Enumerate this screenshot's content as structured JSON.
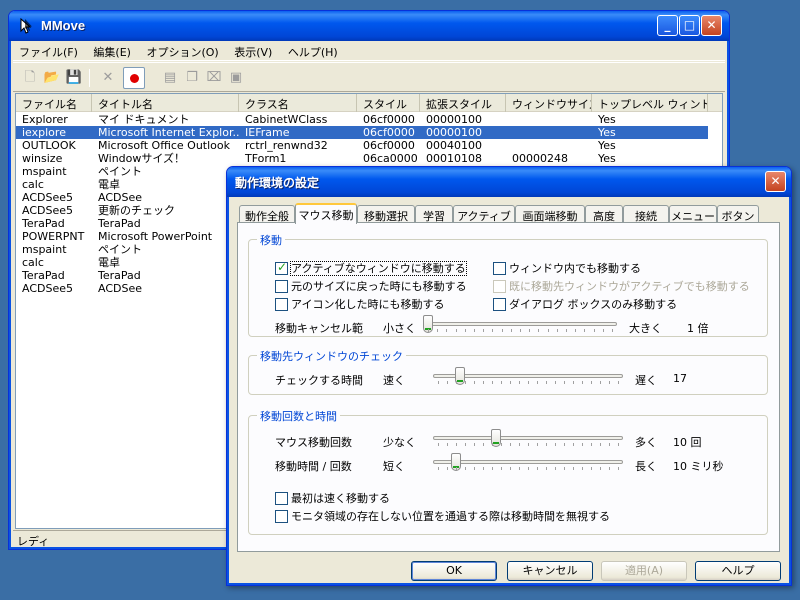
{
  "main": {
    "title": "MMove",
    "menu": [
      "ファイル(F)",
      "編集(E)",
      "オプション(O)",
      "表示(V)",
      "ヘルプ(H)"
    ],
    "columns": [
      "ファイル名",
      "タイトル名",
      "クラス名",
      "スタイル",
      "拡張スタイル",
      "ウィンドウサイズ",
      "トップレベル ウィンドウ"
    ],
    "rows": [
      [
        "Explorer",
        "マイ ドキュメント",
        "CabinetWClass",
        "06cf0000",
        "00000100",
        "",
        "Yes"
      ],
      [
        "iexplore",
        "Microsoft Internet Explor...",
        "IEFrame",
        "06cf0000",
        "00000100",
        "",
        "Yes"
      ],
      [
        "OUTLOOK",
        "Microsoft Office Outlook",
        "rctrl_renwnd32",
        "06cf0000",
        "00040100",
        "",
        "Yes"
      ],
      [
        "winsize",
        "Windowサイズ！",
        "TForm1",
        "06ca0000",
        "00010108",
        "00000248",
        "Yes"
      ],
      [
        "mspaint",
        "ペイント",
        "",
        "",
        "",
        "",
        ""
      ],
      [
        "calc",
        "電卓",
        "",
        "",
        "",
        "",
        ""
      ],
      [
        "ACDSee5",
        "ACDSee",
        "",
        "",
        "",
        "",
        ""
      ],
      [
        "ACDSee5",
        "更新のチェック",
        "",
        "",
        "",
        "",
        ""
      ],
      [
        "TeraPad",
        "TeraPad",
        "",
        "",
        "",
        "",
        ""
      ],
      [
        "POWERPNT",
        "Microsoft PowerPoint",
        "",
        "",
        "",
        "",
        ""
      ],
      [
        "mspaint",
        "ペイント",
        "",
        "",
        "",
        "",
        ""
      ],
      [
        "calc",
        "電卓",
        "",
        "",
        "",
        "",
        ""
      ],
      [
        "TeraPad",
        "TeraPad",
        "",
        "",
        "",
        "",
        ""
      ],
      [
        "ACDSee5",
        "ACDSee",
        "",
        "",
        "",
        "",
        ""
      ]
    ],
    "selected_row": 1,
    "status": "レディ"
  },
  "dialog": {
    "title": "動作環境の設定",
    "tabs": [
      "動作全般",
      "マウス移動",
      "移動選択",
      "学習",
      "アクティブ",
      "画面端移動",
      "高度",
      "接続",
      "メニュー",
      "ボタン"
    ],
    "active_tab": 1,
    "move_group": {
      "label": "移動",
      "chk_active": "アクティブなウィンドウに移動する",
      "chk_inside": "ウィンドウ内でも移動する",
      "chk_restore": "元のサイズに戻った時にも移動する",
      "chk_already": "既に移動先ウィンドウがアクティブでも移動する",
      "chk_icon": "アイコン化した時にも移動する",
      "chk_dialog": "ダイアログ ボックスのみ移動する",
      "cancel_label": "移動キャンセル範",
      "small": "小さく",
      "large": "大きく",
      "cancel_value": "1 倍",
      "cancel_level": 0.0
    },
    "check_group": {
      "label": "移動先ウィンドウのチェック",
      "time_label": "チェックする時間",
      "fast": "速く",
      "slow": "遅く",
      "value": "17",
      "level": 0.12
    },
    "count_group": {
      "label": "移動回数と時間",
      "count_label": "マウス移動回数",
      "few": "少なく",
      "many": "多く",
      "count_value": "10 回",
      "count_level": 0.32,
      "time_label": "移動時間 / 回数",
      "short": "短く",
      "long": "長く",
      "time_value": "10 ミリ秒",
      "time_level": 0.1,
      "chk_fast_first": "最初は速く移動する",
      "chk_ignore": "モニタ領域の存在しない位置を通過する際は移動時間を無視する"
    },
    "buttons": {
      "ok": "OK",
      "cancel": "キャンセル",
      "apply": "適用(A)",
      "help": "ヘルプ"
    }
  }
}
